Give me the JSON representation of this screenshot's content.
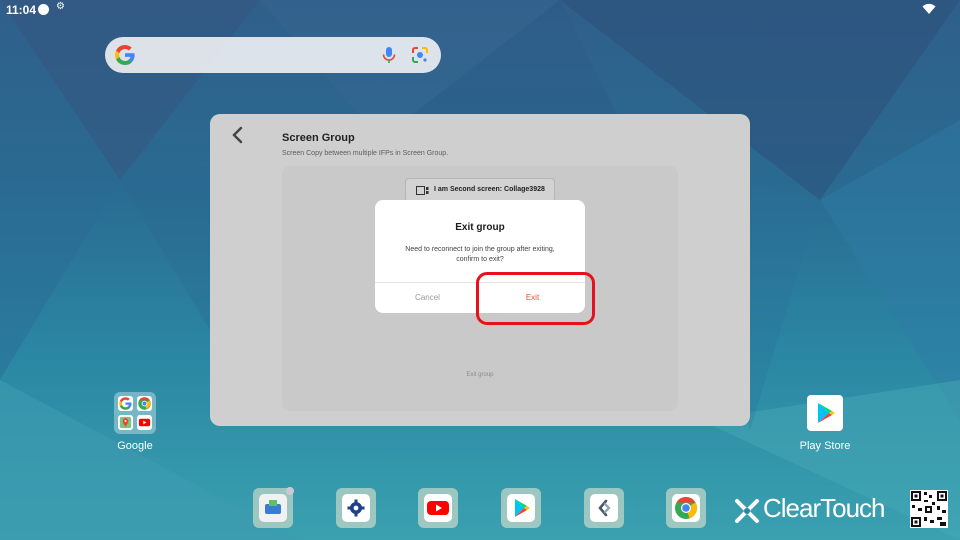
{
  "status_bar": {
    "time": "11:04"
  },
  "panel": {
    "title": "Screen Group",
    "subtitle": "Screen Copy between multiple IFPs in Screen Group.",
    "screen_label": "I am Second screen: Collage3928",
    "exit_group_link": "Exit group"
  },
  "dialog": {
    "title": "Exit group",
    "message_line1": "Need to reconnect to join the group after exiting,",
    "message_line2": "confirm to exit?",
    "cancel_label": "Cancel",
    "exit_label": "Exit"
  },
  "desktop": {
    "folder_label": "Google",
    "playstore_label": "Play Store"
  },
  "brand": {
    "name": "ClearTouch"
  },
  "colors": {
    "exit_accent": "#e5533c",
    "highlight": "#e8101c",
    "wallpaper_top": "#2f5f8a",
    "wallpaper_bottom": "#3aa1b0"
  },
  "icons": {
    "search": "google-g-icon",
    "voice": "microphone-icon",
    "lens": "google-lens-icon",
    "back": "back-chevron-icon",
    "dock": [
      "cleartouch-app-icon",
      "settings-icon",
      "youtube-icon",
      "play-store-icon",
      "screen-share-icon",
      "chrome-icon"
    ]
  }
}
